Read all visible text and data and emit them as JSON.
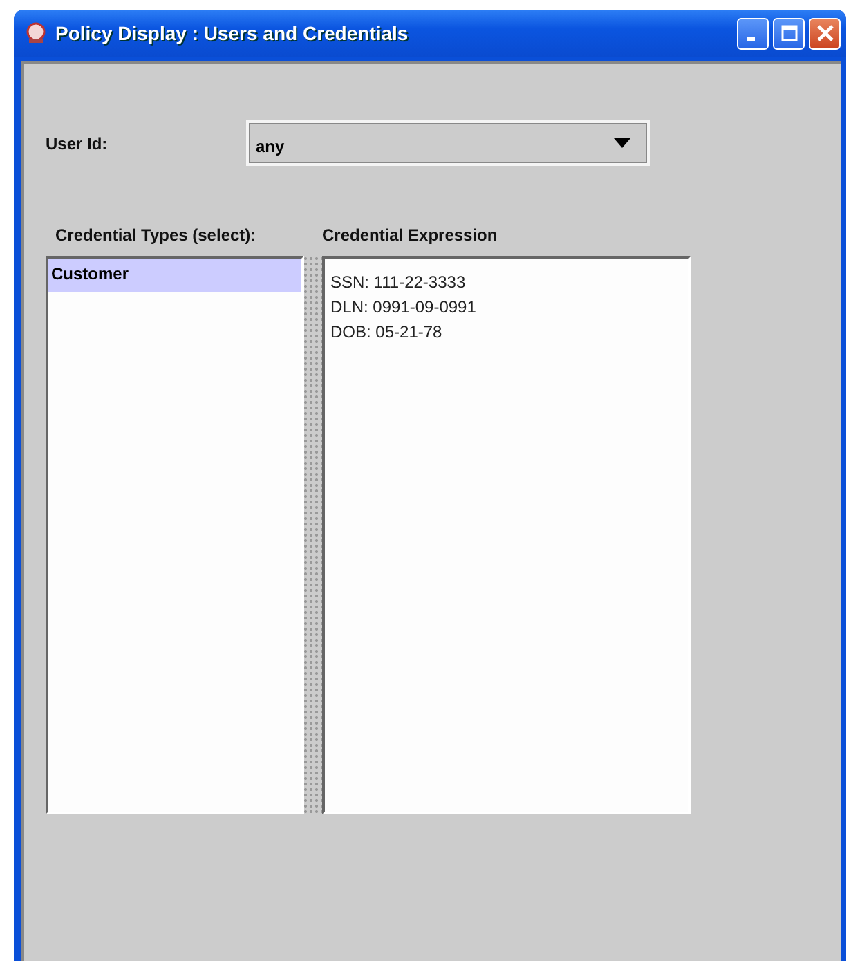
{
  "window": {
    "title": "Policy Display : Users and Credentials"
  },
  "user_id": {
    "label": "User Id:",
    "value": "any"
  },
  "credential_types": {
    "heading": "Credential Types (select):",
    "items": [
      {
        "label": "Customer",
        "selected": true
      }
    ]
  },
  "credential_expression": {
    "heading": "Credential Expression",
    "lines": [
      "SSN: 111-22-3333",
      "DLN: 0991-09-0991",
      "DOB: 05-21-78"
    ]
  }
}
